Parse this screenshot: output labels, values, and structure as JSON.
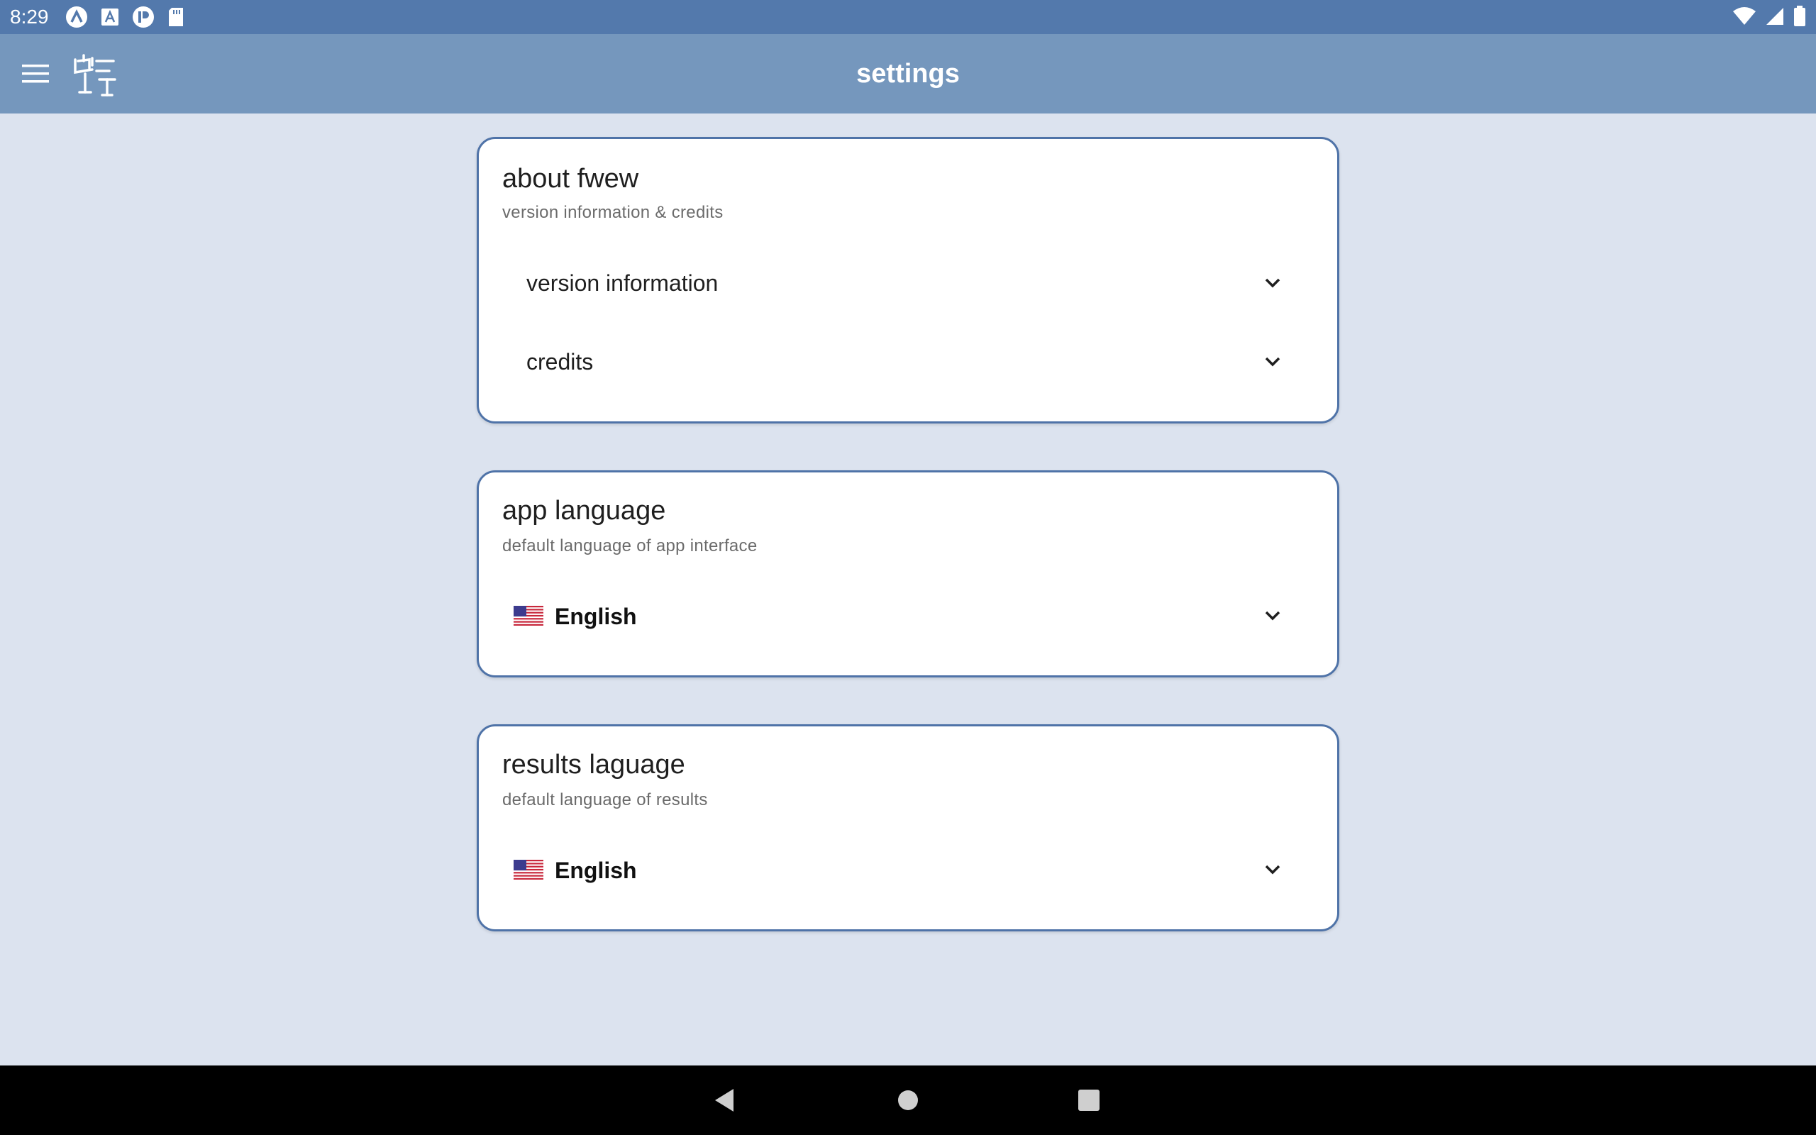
{
  "status_bar": {
    "time": "8:29",
    "notification_icons": [
      "app-a-icon",
      "app-font-icon",
      "app-p-icon",
      "sd-card-icon"
    ],
    "system_icons": [
      "wifi-icon",
      "cell-signal-icon",
      "battery-icon"
    ]
  },
  "app_bar": {
    "title": "settings",
    "menu_icon": "hamburger-menu-icon",
    "logo_icon": "app-logo-icon"
  },
  "cards": {
    "about": {
      "title": "about fwew",
      "subtitle": "version information & credits",
      "items": [
        {
          "label": "version information"
        },
        {
          "label": "credits"
        }
      ]
    },
    "app_language": {
      "title": "app language",
      "subtitle": "default language of app interface",
      "selected": "English",
      "flag": "us-flag-icon"
    },
    "results_language": {
      "title": "results laguage",
      "subtitle": "default language of results",
      "selected": "English",
      "flag": "us-flag-icon"
    }
  },
  "nav_bar": {
    "buttons": [
      "back-icon",
      "home-icon",
      "recents-icon"
    ]
  },
  "colors": {
    "status_bar": "#5379ac",
    "app_bar": "#7597bd",
    "background": "#dce3ef",
    "card_border": "#4f73a8"
  }
}
